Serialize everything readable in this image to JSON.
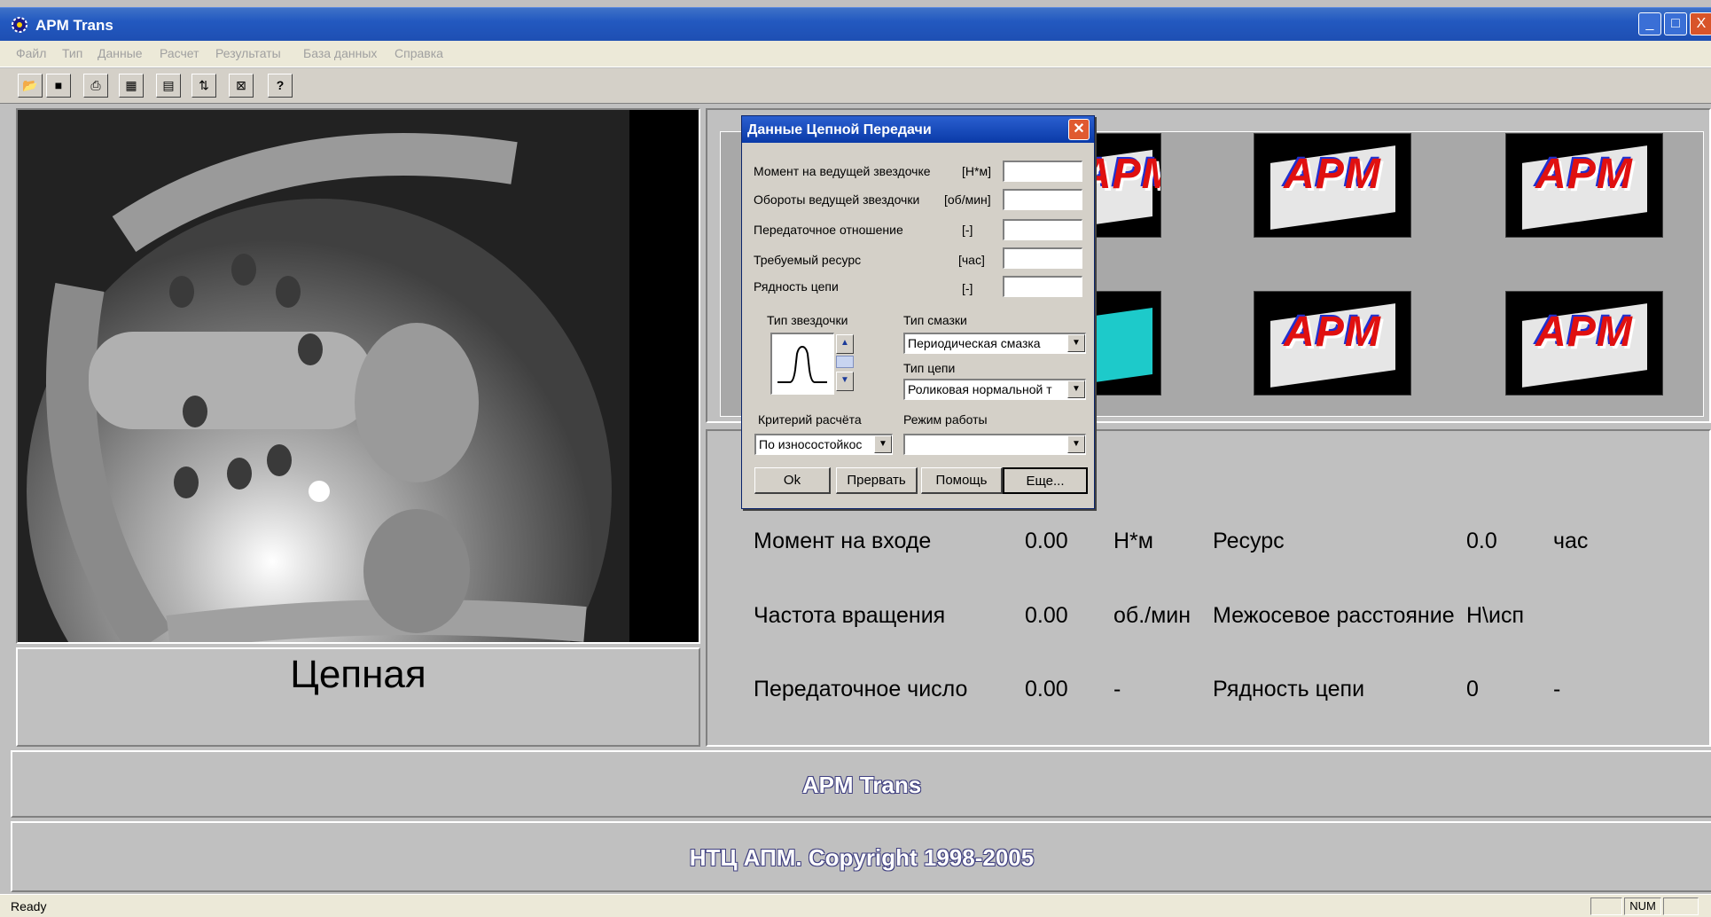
{
  "window": {
    "title": "APM Trans",
    "app_icon": "gear-icon",
    "controls": {
      "minimize": "_",
      "maximize": "□",
      "close": "X"
    }
  },
  "menu": [
    "Файл",
    "Тип",
    "Данные",
    "Расчет",
    "Результаты",
    "База данных",
    "Справка"
  ],
  "toolbar": [
    {
      "name": "open",
      "glyph": "📂"
    },
    {
      "name": "save",
      "glyph": "■"
    },
    {
      "name": "print",
      "glyph": "⎙"
    },
    {
      "name": "properties",
      "glyph": "▦"
    },
    {
      "name": "list",
      "glyph": "▤"
    },
    {
      "name": "settings",
      "glyph": "⇅"
    },
    {
      "name": "chart",
      "glyph": "⊠"
    },
    {
      "name": "help",
      "glyph": "?"
    }
  ],
  "left_panel": {
    "caption": "Цепная"
  },
  "logo_text": "APM",
  "results": {
    "rows": [
      {
        "label": "Момент на входе",
        "value": "0.00",
        "unit": "Н*м",
        "label2": "Ресурс",
        "value2": "0.0",
        "unit2": "час"
      },
      {
        "label": "Частота вращения",
        "value": "0.00",
        "unit": "об./мин",
        "label2": "Межосевое расстояние",
        "value2": "Н\\исп",
        "unit2": ""
      },
      {
        "label": "Передаточное число",
        "value": "0.00",
        "unit": "-",
        "label2": "Рядность цепи",
        "value2": "0",
        "unit2": "-"
      }
    ]
  },
  "footer": {
    "product": "APM Trans",
    "copyright": "НТЦ АПМ. Copyright 1998-2005"
  },
  "status": {
    "text": "Ready",
    "num": "NUM"
  },
  "dialog": {
    "title": "Данные Цепной Передачи",
    "fields": [
      {
        "label": "Момент на ведущей звездочке",
        "unit": "[Н*м]",
        "value": ""
      },
      {
        "label": "Обороты ведущей звездочки",
        "unit": "[об/мин]",
        "value": ""
      },
      {
        "label": "Передаточное  отношение",
        "unit": "[-]",
        "value": ""
      },
      {
        "label": "Требуемый  ресурс",
        "unit": "[час]",
        "value": ""
      },
      {
        "label": "Рядность цепи",
        "unit": "[-]",
        "value": ""
      }
    ],
    "sprocket_type_label": "Тип звездочки",
    "lubrication_label": "Тип смазки",
    "lubrication_value": "Периодическая смазка",
    "chain_type_label": "Тип цепи",
    "chain_type_value": "Роликовая нормальной т",
    "criterion_label": "Критерий расчёта",
    "criterion_value": "По износостойкос",
    "mode_label": "Режим работы",
    "mode_value": "",
    "buttons": {
      "ok": "Ok",
      "cancel": "Прервать",
      "help": "Помощь",
      "more": "Еще..."
    }
  }
}
